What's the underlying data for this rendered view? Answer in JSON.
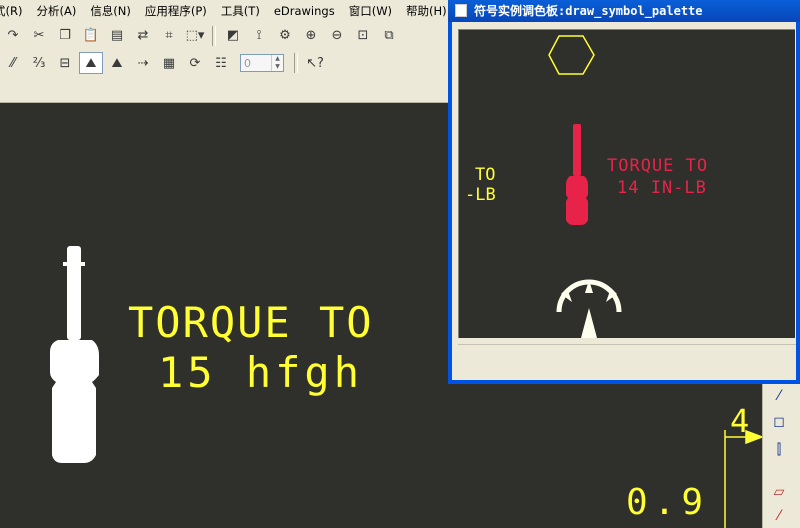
{
  "menubar": {
    "items": [
      {
        "label": "式(R)"
      },
      {
        "label": "分析(A)"
      },
      {
        "label": "信息(N)"
      },
      {
        "label": "应用程序(P)"
      },
      {
        "label": "工具(T)"
      },
      {
        "label": "eDrawings"
      },
      {
        "label": "窗口(W)"
      },
      {
        "label": "帮助(H)"
      }
    ]
  },
  "toolbar": {
    "spin_value": "0"
  },
  "canvas": {
    "symbol_line1": "TORQUE TO",
    "symbol_line2": "15 hfgh",
    "dimension_4": "4",
    "dimension_09": "0.9"
  },
  "palette": {
    "title": "符号实例调色板:draw_symbol_palette",
    "partial_to": "TO",
    "partial_lb": "-LB",
    "red_line1": "TORQUE TO",
    "red_line2": "14 IN-LB"
  },
  "colors": {
    "canvas_bg": "#2f2f2b",
    "yellow_text": "#ffff33",
    "red_symbol": "#e8234a",
    "white_symbol": "#ffffff",
    "titlebar_blue": "#0054e3"
  }
}
